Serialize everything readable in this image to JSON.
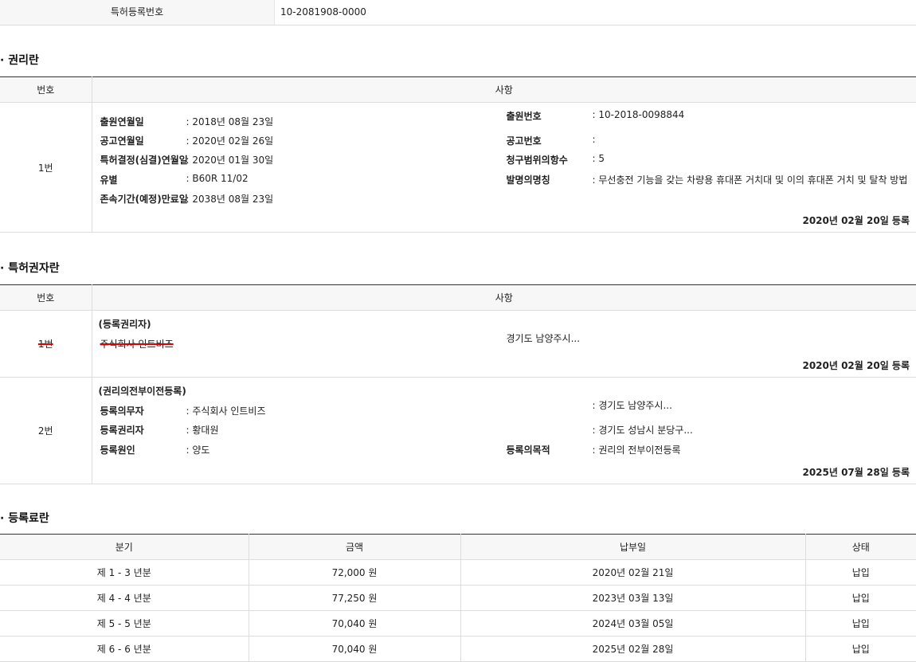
{
  "registration": {
    "label": "특허등록번호",
    "value": "10-2081908-0000"
  },
  "rights": {
    "title": "· 권리란",
    "headers": {
      "no": "번호",
      "detail": "사항"
    },
    "row": {
      "no": "1번",
      "left": [
        {
          "k": "출원연월일",
          "v": ": 2018년 08월 23일"
        },
        {
          "k": "공고연월일",
          "v": ": 2020년 02월 26일"
        },
        {
          "k": "특허결정(심결)연월일",
          "v": ": 2020년 01월 30일"
        },
        {
          "k": "유별",
          "v": ": B60R 11/02"
        },
        {
          "k": "존속기간(예정)만료일",
          "v": ": 2038년 08월 23일"
        }
      ],
      "right": [
        {
          "k": "출원번호",
          "v": ": 10-2018-0098844"
        },
        {
          "k": "공고번호",
          "v": ":"
        },
        {
          "k": "청구범위의항수",
          "v": ": 5"
        },
        {
          "k": "발명의명칭",
          "v": ": 무선충전 기능을 갖는 차량용 휴대폰 거치대 및 이의 휴대폰 거치 및 탈착 방법"
        }
      ],
      "date": "2020년 02월 20일 등록"
    }
  },
  "holders": {
    "title": "· 특허권자란",
    "headers": {
      "no": "번호",
      "detail": "사항"
    },
    "row1": {
      "no": "1번",
      "type": "(등록권리자)",
      "name": "주식회사 인트비즈",
      "address": "경기도 남양주시...",
      "date": "2020년 02월 20일 등록"
    },
    "row2": {
      "no": "2번",
      "type": "(권리의전부이전등록)",
      "items": [
        {
          "k": "등록의무자",
          "v": ": 주식회사 인트비즈"
        },
        {
          "k": "등록권리자",
          "v": ": 황대원"
        },
        {
          "k": "등록원인",
          "v": ": 양도"
        }
      ],
      "addr1": ": 경기도 남양주시...",
      "addr2": ": 경기도 성남시 분당구...",
      "purpose_k": "등록의목적",
      "purpose_v": ": 권리의 전부이전등록",
      "date": "2025년 07월 28일 등록"
    }
  },
  "fees": {
    "title": "· 등록료란",
    "headers": [
      "분기",
      "금액",
      "납부일",
      "상태"
    ],
    "rows": [
      [
        "제 1 - 3 년분",
        "72,000 원",
        "2020년 02월 21일",
        "납입"
      ],
      [
        "제 4 - 4 년분",
        "77,250 원",
        "2023년 03월 13일",
        "납입"
      ],
      [
        "제 5 - 5 년분",
        "70,040 원",
        "2024년 03월 05일",
        "납입"
      ],
      [
        "제 6 - 6 년분",
        "70,040 원",
        "2025년 02월 28일",
        "납입"
      ]
    ]
  }
}
